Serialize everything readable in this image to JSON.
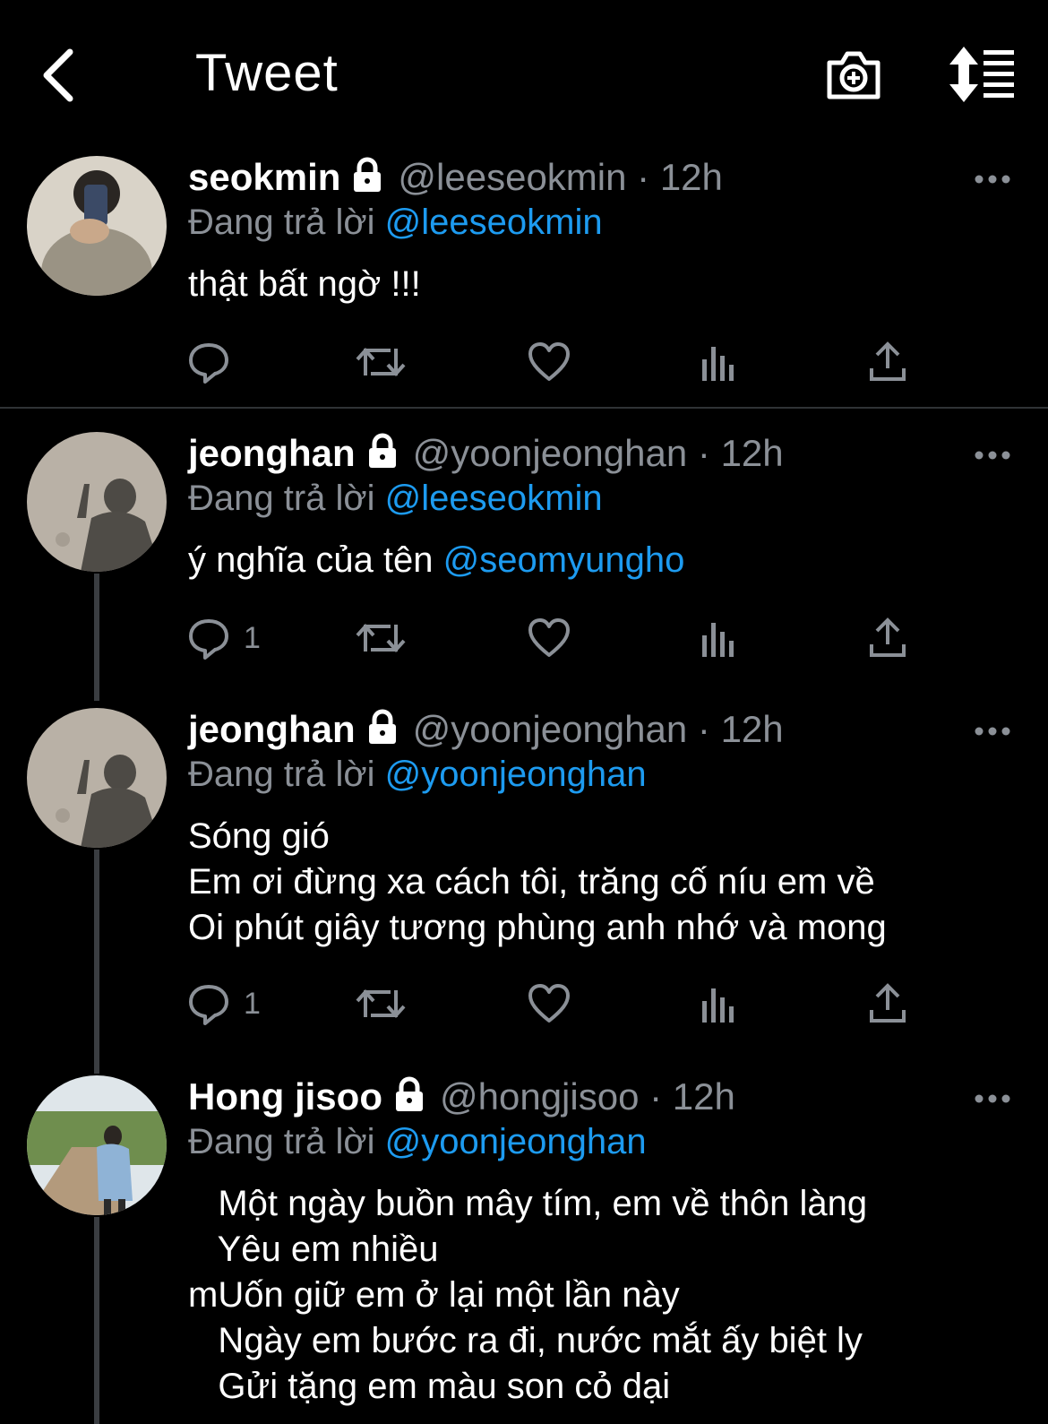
{
  "header": {
    "title": "Tweet"
  },
  "tweets": [
    {
      "name": "seokmin",
      "handle": "@leeseokmin",
      "dot": "·",
      "time": "12h",
      "reply_label": "Đang trả lời",
      "reply_to": "@leeseokmin",
      "text": "thật bất ngờ !!!",
      "reply_count": ""
    },
    {
      "name": "jeonghan",
      "handle": "@yoonjeonghan",
      "dot": "·",
      "time": "12h",
      "reply_label": "Đang trả lời",
      "reply_to": "@leeseokmin",
      "text": "ý nghĩa của tên",
      "text_mention": "@seomyungho",
      "reply_count": "1"
    },
    {
      "name": "jeonghan",
      "handle": "@yoonjeonghan",
      "dot": "·",
      "time": "12h",
      "reply_label": "Đang trả lời",
      "reply_to": "@yoonjeonghan",
      "text": "Sóng gió\nEm ơi đừng xa cách tôi, trăng cố níu em về\nOi phút giây tương phùng anh nhớ và mong",
      "reply_count": "1"
    },
    {
      "name": "Hong jisoo",
      "handle": "@hongjisoo",
      "dot": "·",
      "time": "12h",
      "reply_label": "Đang trả lời",
      "reply_to": "@yoonjeonghan",
      "text": "   Một ngày buồn mây tím, em về thôn làng\n   Yêu em nhiều\nmUốn giữ em ở lại một lần này\n   Ngày em bước ra đi, nước mắt ấy biệt ly\n   Gửi tặng em màu son cỏ dại",
      "reply_count": ""
    }
  ],
  "colors": {
    "background": "#000000",
    "accent": "#1d9bf0",
    "secondary_text": "#8b9097"
  }
}
